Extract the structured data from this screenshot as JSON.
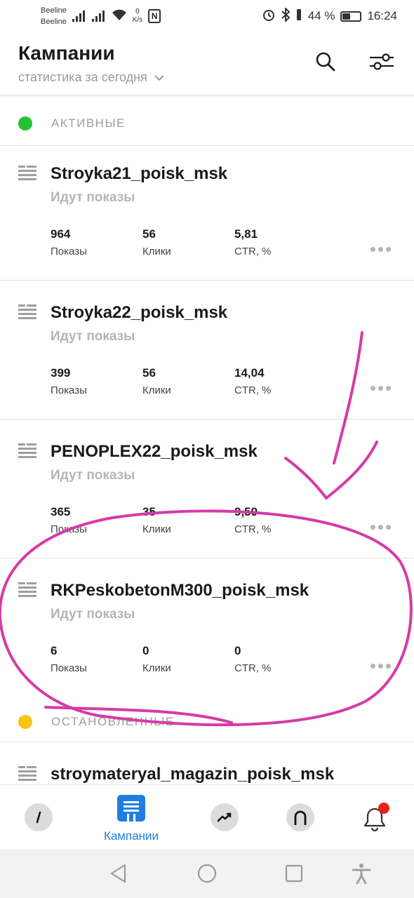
{
  "status_bar": {
    "carrier1": "Beeline",
    "carrier2": "Beeline",
    "speed_value": "0",
    "speed_unit": "K/s",
    "nfc": "N",
    "battery_text": "44 %",
    "battery_level": 0.44,
    "time": "16:24"
  },
  "header": {
    "title": "Кампании",
    "subtitle": "статистика за сегодня"
  },
  "sections": {
    "active": "АКТИВНЫЕ",
    "stopped": "ОСТАНОВЛЕННЫЕ"
  },
  "colors": {
    "active_dot": "#22c232",
    "stopped_dot": "#f5c518",
    "accent": "#1f7fe0",
    "annotation": "#d63aa6",
    "badge": "#e8201f"
  },
  "stat_labels": {
    "shows": "Показы",
    "clicks": "Клики",
    "ctr": "CTR, %"
  },
  "campaigns": [
    {
      "name": "Stroyka21_poisk_msk",
      "status": "Идут показы",
      "shows": "964",
      "clicks": "56",
      "ctr": "5,81"
    },
    {
      "name": "Stroyka22_poisk_msk",
      "status": "Идут показы",
      "shows": "399",
      "clicks": "56",
      "ctr": "14,04"
    },
    {
      "name": "PENOPLEX22_poisk_msk",
      "status": "Идут показы",
      "shows": "365",
      "clicks": "35",
      "ctr": "9,59"
    },
    {
      "name": "RKPeskobetonM300_poisk_msk",
      "status": "Идут показы",
      "shows": "6",
      "clicks": "0",
      "ctr": "0"
    }
  ],
  "stopped_campaigns": [
    {
      "name": "stroymateryal_magazin_poisk_msk"
    }
  ],
  "bottom_nav": {
    "campaigns_label": "Кампании"
  }
}
